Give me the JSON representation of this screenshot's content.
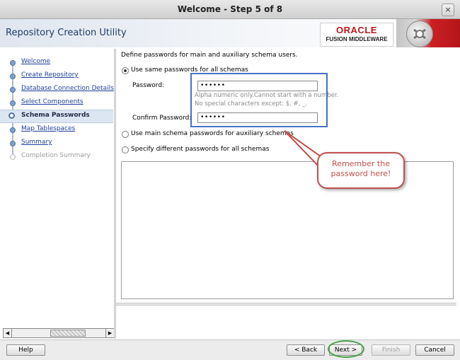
{
  "window": {
    "title": "Welcome - Step 5 of 8",
    "close_symbol": "×"
  },
  "header": {
    "app_title": "Repository Creation Utility",
    "logo_line1": "ORACLE",
    "logo_line2": "FUSION MIDDLEWARE"
  },
  "nav": {
    "items": [
      {
        "label": "Welcome",
        "state": "link"
      },
      {
        "label": "Create Repository",
        "state": "link"
      },
      {
        "label": "Database Connection Details",
        "state": "link"
      },
      {
        "label": "Select Components",
        "state": "link"
      },
      {
        "label": "Schema Passwords",
        "state": "active"
      },
      {
        "label": "Map Tablespaces",
        "state": "link"
      },
      {
        "label": "Summary",
        "state": "link"
      },
      {
        "label": "Completion Summary",
        "state": "disabled"
      }
    ]
  },
  "main": {
    "intro": "Define passwords for main and auxiliary schema users.",
    "option_same": "Use same passwords for all schemas",
    "password_label": "Password:",
    "password_value": "••••••",
    "hint_line1": "Alpha numeric only.Cannot start with a number.",
    "hint_line2": "No special characters except: $, #, _.",
    "confirm_label": "Confirm Password:",
    "confirm_value": "••••••",
    "option_main": "Use main schema passwords for auxiliary schemas",
    "option_different": "Specify different passwords for all schemas",
    "selected_option": "same"
  },
  "callout": {
    "line1": "Remember the",
    "line2": "password here!",
    "color": "#c0504d"
  },
  "buttons": {
    "help": "Help",
    "back": "< Back",
    "next": "Next >",
    "finish": "Finish",
    "cancel": "Cancel"
  },
  "colors": {
    "highlight_box": "#4472c4",
    "next_ring": "#4aa24a",
    "oracle_red": "#c0161b"
  }
}
